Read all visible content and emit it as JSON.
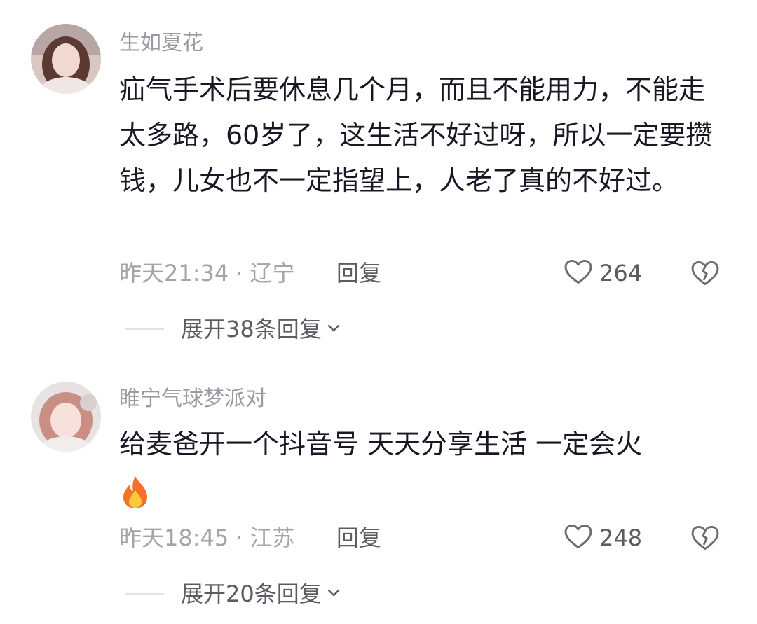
{
  "comments": [
    {
      "username": "生如夏花",
      "text": "疝气手术后要休息几个月，而且不能用力，不能走太多路，60岁了，这生活不好过呀，所以一定要攒钱，儿女也不一定指望上，人老了真的不好过。",
      "time": "昨天21:34",
      "location": "辽宁",
      "reply_label": "回复",
      "likes": "264",
      "expand_label": "展开38条回复"
    },
    {
      "username": "睢宁气球梦派对",
      "text": "给麦爸开一个抖音号  天天分享生活  一定会火",
      "emoji": "fire-emoji",
      "time": "昨天18:45",
      "location": "江苏",
      "reply_label": "回复",
      "likes": "248",
      "expand_label": "展开20条回复"
    }
  ],
  "separator": "·",
  "colors": {
    "username": "#9a9ba0",
    "text": "#161823",
    "meta": "#a3a4a8",
    "action": "#5c5d63"
  }
}
